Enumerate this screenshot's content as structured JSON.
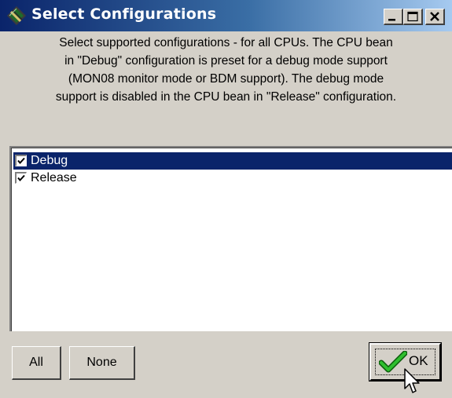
{
  "window": {
    "title": "Select Configurations",
    "icon": "config-bean-icon",
    "controls": [
      "minimize-icon",
      "maximize-icon",
      "close-icon"
    ]
  },
  "description": {
    "lines": [
      "Select supported configurations - for all CPUs. The CPU bean",
      "in \"Debug\" configuration is preset for a debug mode support",
      "(MON08 monitor mode or BDM support). The debug mode",
      "support is disabled in the CPU bean in \"Release\" configuration."
    ]
  },
  "configurations": [
    {
      "label": "Debug",
      "checked": true,
      "selected": true
    },
    {
      "label": "Release",
      "checked": true,
      "selected": false
    }
  ],
  "buttons": {
    "all_label": "All",
    "none_label": "None",
    "ok_label": "OK"
  },
  "colors": {
    "selection": "#0a246a",
    "face": "#d4d0c8",
    "ok_check": "#1e9e1e"
  }
}
